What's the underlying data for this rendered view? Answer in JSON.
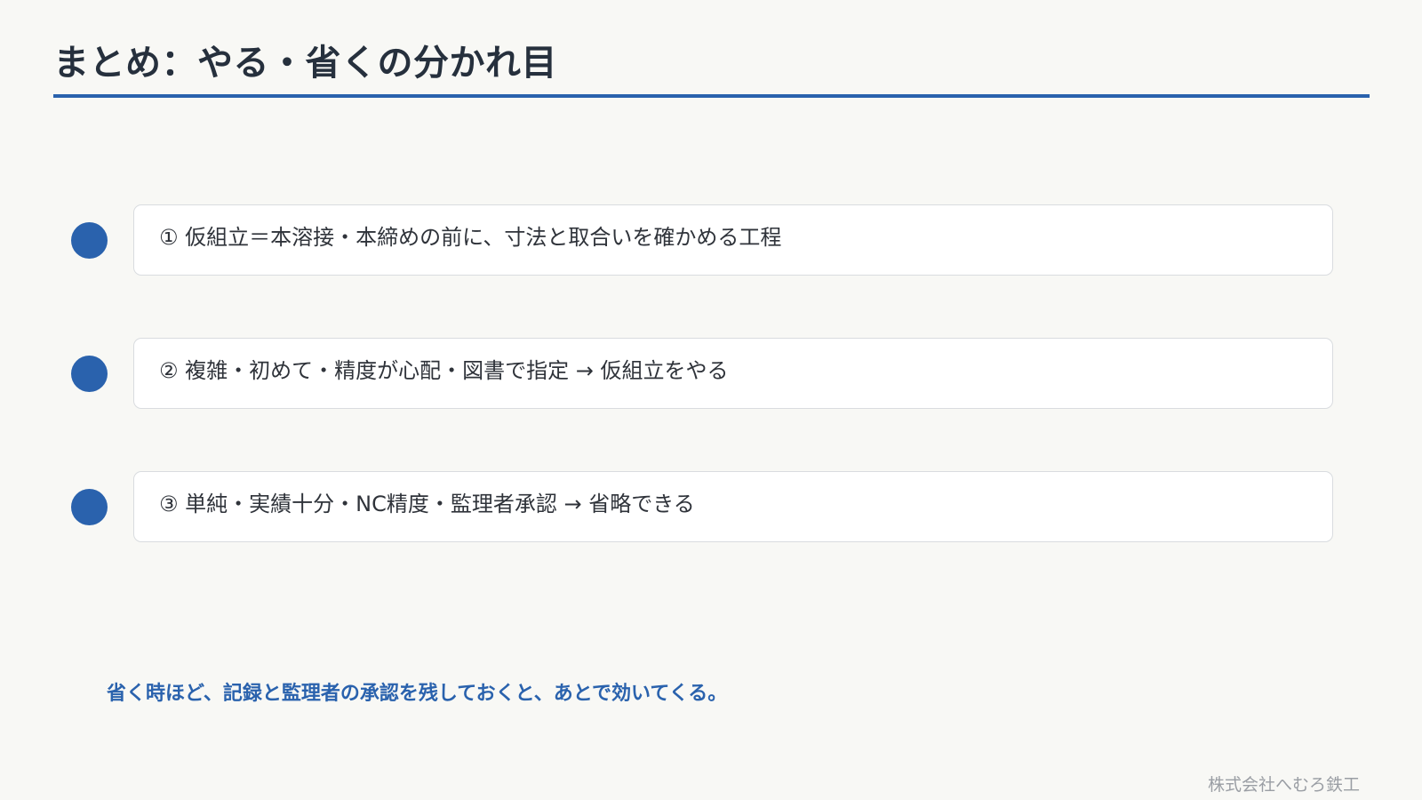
{
  "slide": {
    "title": "まとめ：やる・省くの分かれ目"
  },
  "points": [
    {
      "text": "① 仮組立＝本溶接・本締めの前に、寸法と取合いを確かめる工程"
    },
    {
      "text": "② 複雑・初めて・精度が心配・図書で指定 → 仮組立をやる"
    },
    {
      "text": "③ 単純・実績十分・NC精度・監理者承認 → 省略できる"
    }
  ],
  "key_message": "省く時ほど、記録と監理者の承認を残しておくと、あとで効いてくる。",
  "footer": {
    "company": "株式会社へむろ鉄工"
  },
  "colors": {
    "accent": "#2a62ad",
    "title": "#26303d",
    "muted": "#9a9ea4"
  }
}
